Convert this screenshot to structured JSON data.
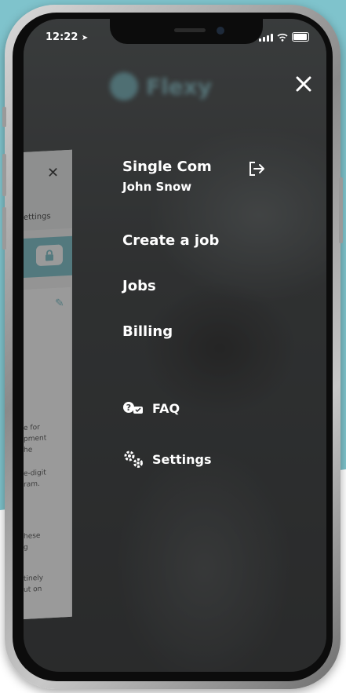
{
  "status_bar": {
    "time": "12:22"
  },
  "brand": {
    "name": "Flexy"
  },
  "background_card": {
    "settings_label": "ettings",
    "text_lines": [
      "e for",
      "pment",
      "he",
      "e-digit",
      "ram.",
      "hese",
      "g",
      "tinely",
      "ut on"
    ]
  },
  "menu": {
    "account_name": "Single Com",
    "user_name": "John Snow",
    "items": [
      {
        "label": "Create a job"
      },
      {
        "label": "Jobs"
      },
      {
        "label": "Billing"
      }
    ],
    "secondary": [
      {
        "label": "FAQ",
        "icon": "faq-icon"
      },
      {
        "label": "Settings",
        "icon": "gears-icon"
      }
    ]
  },
  "colors": {
    "accent": "#7fc3cc",
    "menu_text": "#ffffff"
  }
}
